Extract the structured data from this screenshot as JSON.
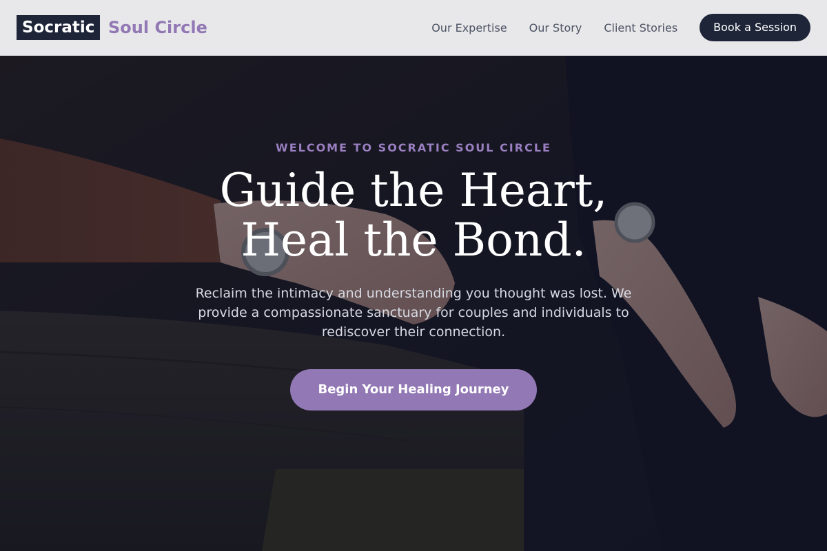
{
  "brand": {
    "mark": "Socratic",
    "name": "Soul Circle",
    "accent_color": "#9278b4",
    "dark_color": "#1e2538"
  },
  "nav": {
    "links": [
      "Our Expertise",
      "Our Story",
      "Client Stories"
    ],
    "cta": "Book a Session"
  },
  "hero": {
    "eyebrow": "WELCOME TO SOCRATIC SOUL CIRCLE",
    "headline_line1": "Guide the Heart,",
    "headline_line2": "Heal the Bond.",
    "subtext": "Reclaim the intimacy and understanding you thought was lost. We provide a compassionate sanctuary for couples and individuals to rediscover their connection.",
    "cta": "Begin Your Healing Journey",
    "background_image": "two people holding hands wearing wristwatches, leaning on a wooden fence"
  }
}
